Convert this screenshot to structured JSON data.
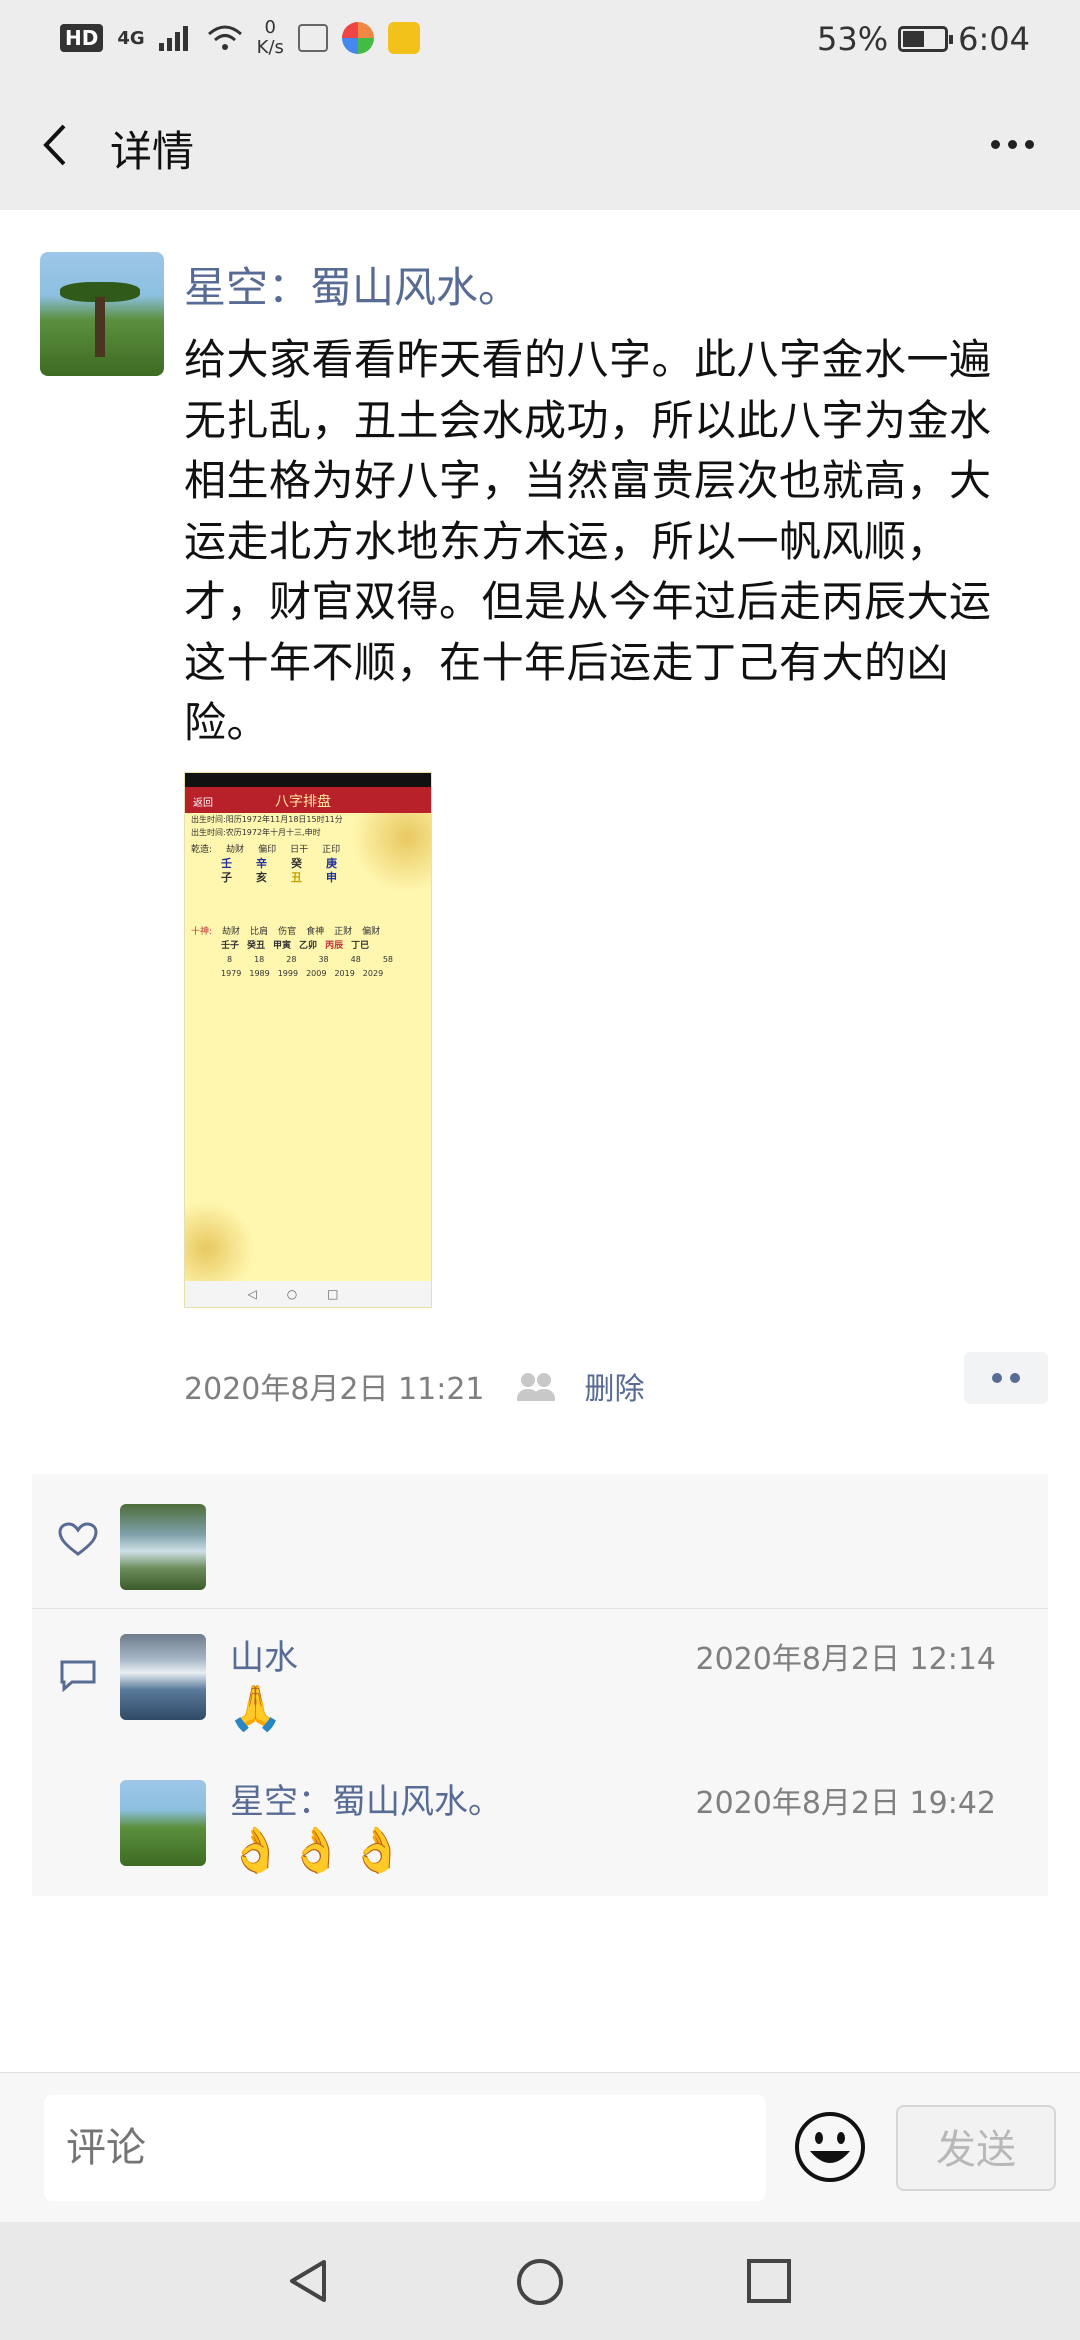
{
  "status_bar": {
    "hd": "HD",
    "network": "4G",
    "speed_value": "0",
    "speed_unit": "K/s",
    "battery": "53%",
    "battery_level": 0.53,
    "time": "6:04"
  },
  "header": {
    "title": "详情"
  },
  "post": {
    "author": "星空：蜀山风水。",
    "text": "给大家看看昨天看的八字。此八字金水一遍无扎乱，丑土会水成功，所以此八字为金水相生格为好八字，当然富贵层次也就高，大运走北方水地东方木运，所以一帆风顺，才，财官双得。但是从今年过后走丙辰大运这十年不顺，在十年后运走丁己有大的凶险。",
    "time": "2020年8月2日 11:21",
    "delete_label": "删除"
  },
  "image_preview": {
    "back": "返回",
    "app_title": "八字排盘",
    "birth_solar": "出生时间:阳历1972年11月18日15时11分",
    "birth_lunar": "出生时间:农历1972年十月十三,申时",
    "row_label": "乾造:",
    "ten_gods": [
      "劫财",
      "偏印",
      "日干",
      "正印"
    ],
    "stems": [
      "壬",
      "辛",
      "癸",
      "庚"
    ],
    "branches": [
      "子",
      "亥",
      "丑",
      "申"
    ],
    "luck_label": "十神:",
    "luck_gods": [
      "劫财",
      "比肩",
      "伤官",
      "食神",
      "正财",
      "偏财"
    ],
    "luck_pillars": [
      "壬子",
      "癸丑",
      "甲寅",
      "乙卯",
      "丙辰",
      "丁巳"
    ],
    "luck_ages": [
      "8",
      "18",
      "28",
      "38",
      "48",
      "58"
    ],
    "luck_years": [
      "1979",
      "1989",
      "1999",
      "2009",
      "2019",
      "2029"
    ]
  },
  "comments": [
    {
      "name": "山水",
      "time": "2020年8月2日 12:14",
      "text": "🙏"
    },
    {
      "name": "星空：蜀山风水。",
      "time": "2020年8月2日 19:42",
      "text": "👌👌👌"
    }
  ],
  "input": {
    "placeholder": "评论",
    "send_label": "发送"
  }
}
